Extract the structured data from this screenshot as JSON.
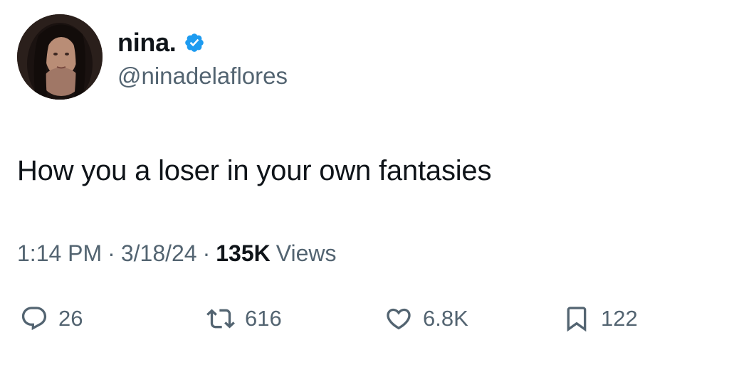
{
  "author": {
    "display_name": "nina.",
    "handle": "@ninadelaflores",
    "avatar_icon": "profile-photo",
    "verified_icon": "verified-badge-icon",
    "verified_color": "#1d9bf0"
  },
  "tweet": {
    "text": "How you a loser in your own fantasies",
    "time": "1:14 PM",
    "date": "3/18/24",
    "separator": "·",
    "views_count": "135K",
    "views_label": "Views"
  },
  "actions": {
    "reply": {
      "icon": "reply-icon",
      "count": "26"
    },
    "retweet": {
      "icon": "retweet-icon",
      "count": "616"
    },
    "like": {
      "icon": "heart-icon",
      "count": "6.8K"
    },
    "bookmark": {
      "icon": "bookmark-icon",
      "count": "122"
    }
  },
  "colors": {
    "text_primary": "#0f1419",
    "text_secondary": "#536471"
  }
}
